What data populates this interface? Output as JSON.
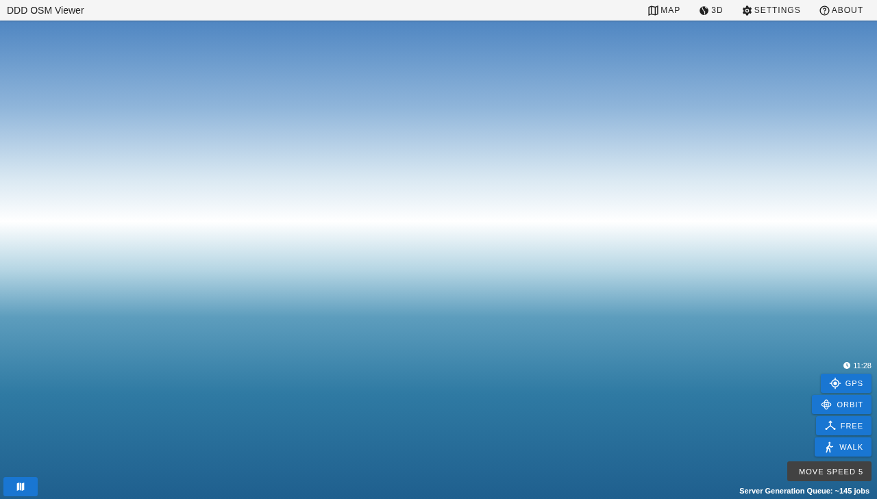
{
  "app_bar": {
    "title": "DDD OSM Viewer",
    "nav": [
      {
        "kind": "map",
        "label": "MAP"
      },
      {
        "kind": "globe",
        "label": "3D"
      },
      {
        "kind": "gear",
        "label": "SETTINGS"
      },
      {
        "kind": "help",
        "label": "ABOUT"
      }
    ]
  },
  "overlay": {
    "time": "11:28",
    "modes": [
      {
        "kind": "gps",
        "label": "GPS"
      },
      {
        "kind": "orbit",
        "label": "ORBIT"
      },
      {
        "kind": "free",
        "label": "FREE"
      },
      {
        "kind": "walk",
        "label": "WALK"
      }
    ],
    "move_speed": "MOVE SPEED 5",
    "queue": "Server Generation Queue: ~145 jobs"
  }
}
